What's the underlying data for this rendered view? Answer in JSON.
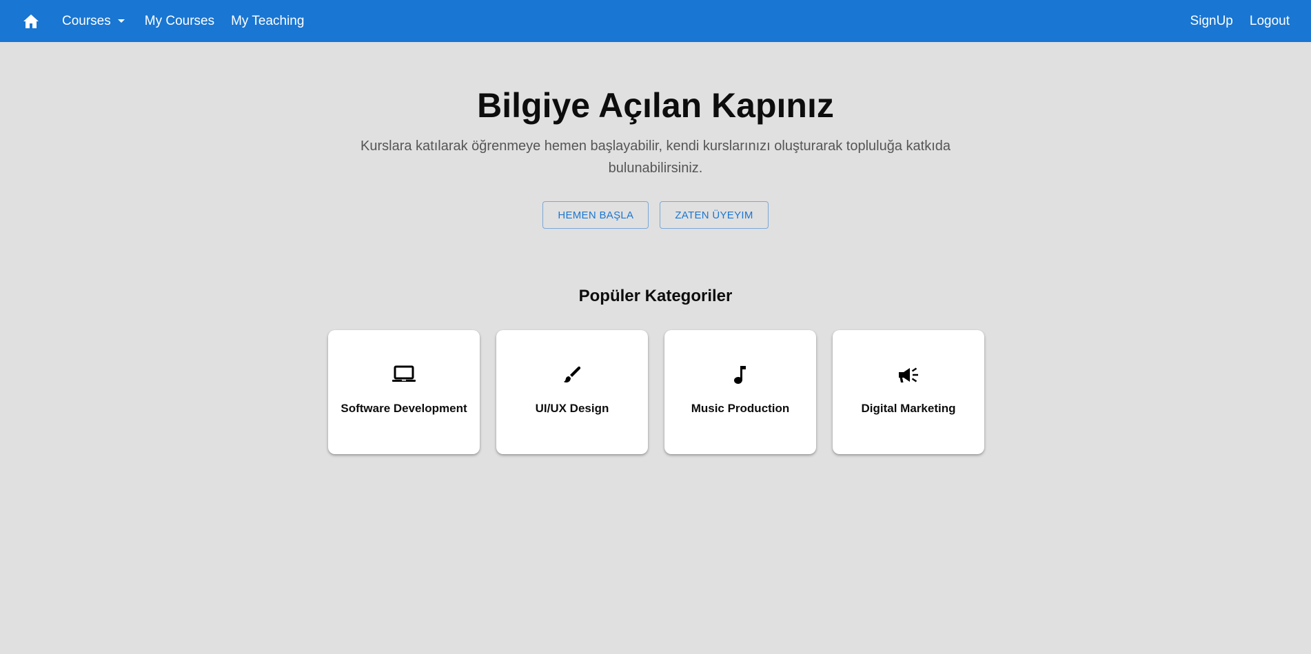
{
  "nav": {
    "home_icon": "home-icon",
    "courses_label": "Courses",
    "my_courses_label": "My Courses",
    "my_teaching_label": "My Teaching",
    "signup_label": "SignUp",
    "logout_label": "Logout",
    "bar_color": "#1976d2"
  },
  "hero": {
    "title": "Bilgiye Açılan Kapınız",
    "subtitle": "Kurslara katılarak öğrenmeye hemen başlayabilir, kendi kurslarınızı oluşturarak topluluğa katkıda bulunabilirsiniz.",
    "primary_button": "HEMEN BAŞLA",
    "secondary_button": "ZATEN ÜYEYIM"
  },
  "categories": {
    "title": "Popüler Kategoriler",
    "items": [
      {
        "label": "Software Development",
        "icon": "laptop-icon"
      },
      {
        "label": "UI/UX Design",
        "icon": "brush-icon"
      },
      {
        "label": "Music Production",
        "icon": "music-note-icon"
      },
      {
        "label": "Digital Marketing",
        "icon": "megaphone-icon"
      }
    ]
  }
}
